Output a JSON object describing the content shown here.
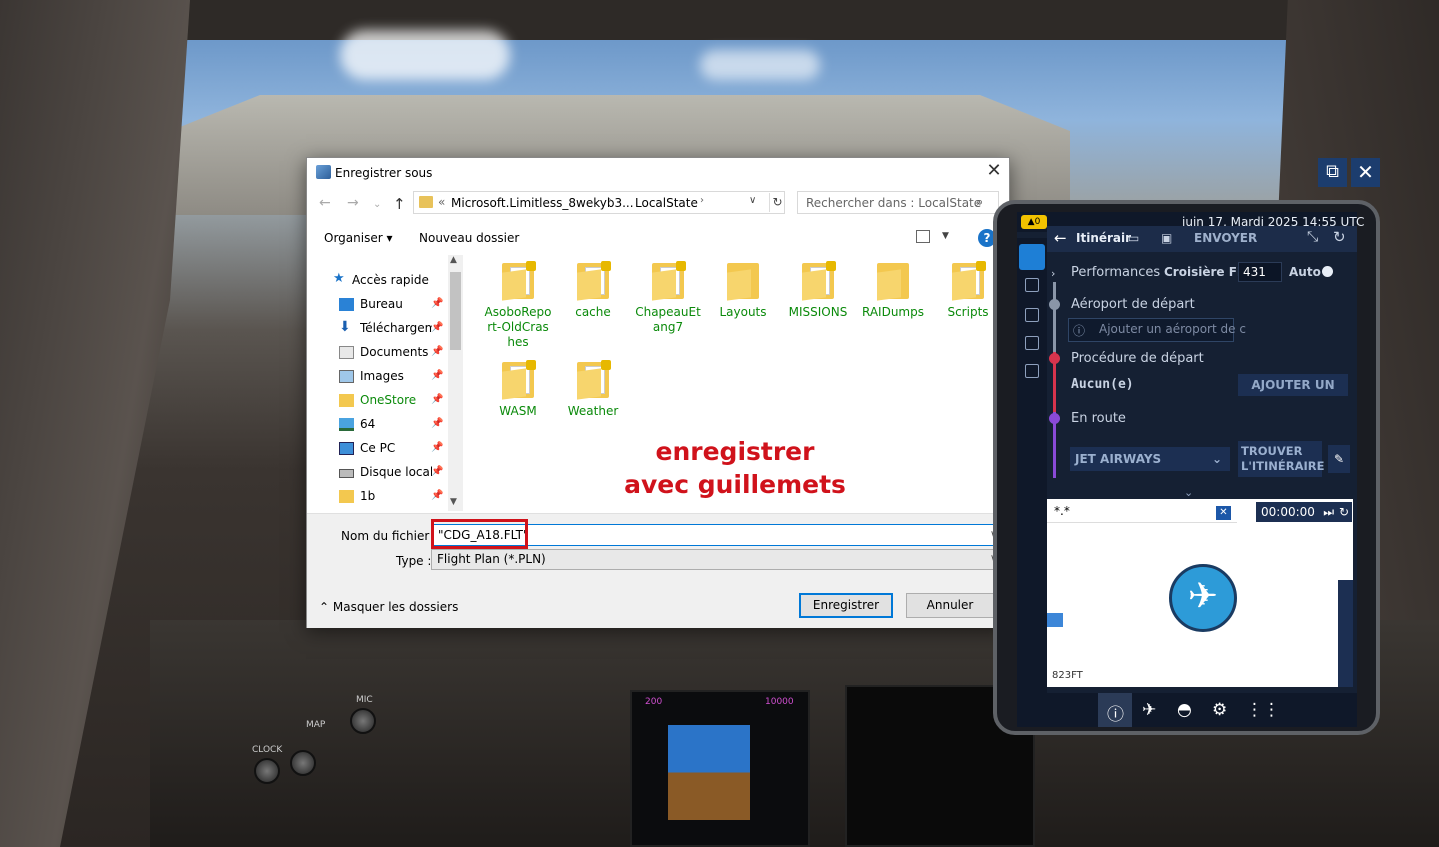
{
  "dialog": {
    "title": "Enregistrer sous",
    "close": "✕",
    "address": {
      "separator": "«",
      "path_part1": "Microsoft.Limitless_8wekyb3...",
      "path_part2": "LocalState",
      "arrow": "›"
    },
    "search_placeholder": "Rechercher dans : LocalState",
    "toolbar": {
      "organize": "Organiser ▾",
      "new_folder": "Nouveau dossier",
      "help": "?"
    },
    "nav_items": [
      {
        "label": "Accès rapide",
        "icon": "star-icon"
      },
      {
        "label": "Bureau",
        "icon": "desktop-icon"
      },
      {
        "label": "Téléchargements",
        "icon": "download-icon"
      },
      {
        "label": "Documents",
        "icon": "documents-icon"
      },
      {
        "label": "Images",
        "icon": "images-icon"
      },
      {
        "label": "OneStore",
        "icon": "folder-icon"
      },
      {
        "label": "64",
        "icon": "network-icon"
      },
      {
        "label": "Ce PC",
        "icon": "computer-icon"
      },
      {
        "label": "Disque local (",
        "icon": "drive-icon"
      },
      {
        "label": "1b",
        "icon": "folder-icon"
      }
    ],
    "files": [
      {
        "name": "AsoboRepo rt-OldCras hes"
      },
      {
        "name": "cache"
      },
      {
        "name": "ChapeauEt ang7"
      },
      {
        "name": "Layouts"
      },
      {
        "name": "MISSIONS"
      },
      {
        "name": "RAIDumps"
      },
      {
        "name": "Scripts"
      },
      {
        "name": "WASM"
      },
      {
        "name": "Weather"
      }
    ],
    "annotation_line1": "enregistrer",
    "annotation_line2": "avec guillemets",
    "filename_label": "Nom du fichier :",
    "filename_value": "\"CDG_A18.FLT\"",
    "type_label": "Type :",
    "type_value": "Flight Plan (*.PLN)",
    "hide_folders": "Masquer les dossiers",
    "save_button": "Enregistrer",
    "cancel_button": "Annuler"
  },
  "tablet": {
    "warning_badge": "▲0",
    "date": "juin 17, Mardi 2025 14:55 UTC",
    "header_title": "Itinérair",
    "send_button": "ENVOYER",
    "performances": "Performances",
    "cruise_label": "Croisière FL",
    "cruise_value": "431",
    "auto_label": "Auto",
    "departure_airport": "Aéroport de départ",
    "departure_input_placeholder": "Ajouter un aéroport de c",
    "departure_procedure": "Procédure de départ",
    "procedure_value": "Aucun(e)",
    "add_button": "AJOUTER UN",
    "en_route": "En route",
    "airline_select": "JET AIRWAYS",
    "find_route_button": "TROUVER L'ITINÉRAIRE",
    "map_search": "*.*",
    "timer": "00:00:00",
    "scale": "823FT"
  },
  "overlay": {
    "popout": "⧉",
    "close": "✕"
  },
  "cockpit": {
    "clock_label": "CLOCK",
    "map_label": "MAP",
    "mic_label": "MIC",
    "speed_tape": "200",
    "alt_tape": "10000"
  },
  "colors": {
    "annotation_red": "#d0121b",
    "folder_text_green": "#0b8a0b",
    "accent_blue": "#0078d7",
    "tablet_bg": "#152033"
  }
}
